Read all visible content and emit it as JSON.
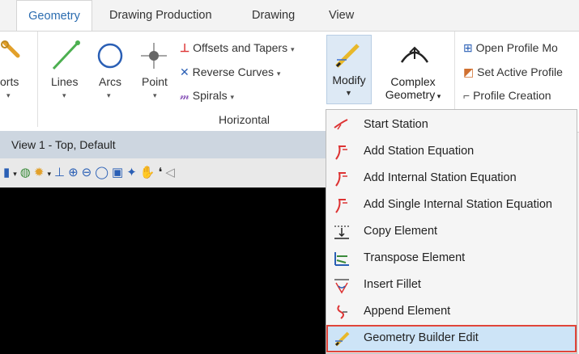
{
  "tabs": [
    {
      "label": "Geometry",
      "active": true
    },
    {
      "label": "Drawing Production",
      "active": false
    },
    {
      "label": "Drawing",
      "active": false
    },
    {
      "label": "View",
      "active": false
    }
  ],
  "ribbon": {
    "ports_label": "orts",
    "lines_label": "Lines",
    "arcs_label": "Arcs",
    "point_label": "Point",
    "offsets_label": "Offsets and Tapers",
    "reverse_label": "Reverse Curves",
    "spirals_label": "Spirals",
    "modify_label": "Modify",
    "complex_label1": "Complex",
    "complex_label2": "Geometry",
    "group_label": "Horizontal",
    "open_profile": "Open Profile Mo",
    "set_active": "Set Active Profile",
    "profile_creation": "Profile Creation"
  },
  "view": {
    "title": "View 1 - Top, Default"
  },
  "menu": {
    "items": [
      {
        "label": "Start Station",
        "icon": "start-station-icon"
      },
      {
        "label": "Add Station Equation",
        "icon": "station-equation-icon"
      },
      {
        "label": "Add Internal Station Equation",
        "icon": "internal-station-equation-icon"
      },
      {
        "label": "Add Single Internal Station Equation",
        "icon": "single-internal-station-equation-icon"
      },
      {
        "label": "Copy Element",
        "icon": "copy-element-icon"
      },
      {
        "label": "Transpose Element",
        "icon": "transpose-element-icon"
      },
      {
        "label": "Insert Fillet",
        "icon": "insert-fillet-icon"
      },
      {
        "label": "Append Element",
        "icon": "append-element-icon"
      },
      {
        "label": "Geometry Builder Edit",
        "icon": "geometry-builder-edit-icon",
        "highlighted": true
      }
    ]
  }
}
